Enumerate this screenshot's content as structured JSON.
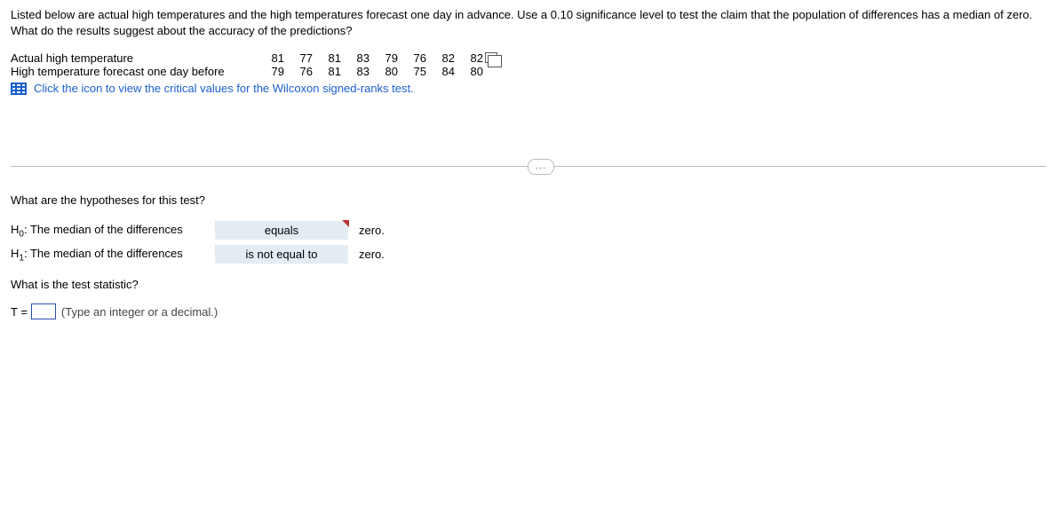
{
  "intro": {
    "line1": "Listed below are actual high temperatures and the high temperatures forecast one day in advance. Use a 0.10 significance level to test the claim that the population of differences has a median of zero.",
    "line2": "What do the results suggest about the accuracy of the predictions?"
  },
  "table": {
    "rows": [
      {
        "label": "Actual high temperature",
        "values": [
          "81",
          "77",
          "81",
          "83",
          "79",
          "76",
          "82",
          "82"
        ]
      },
      {
        "label": "High temperature forecast one day before",
        "values": [
          "79",
          "76",
          "81",
          "83",
          "80",
          "75",
          "84",
          "80"
        ]
      }
    ],
    "link_text": "Click the icon to view the critical values for the Wilcoxon signed-ranks test."
  },
  "ellipsis": "...",
  "hypotheses": {
    "question": "What are the hypotheses for this test?",
    "h0_prefix": "H",
    "h0_sub": "0",
    "h0_label": ": The median of the differences",
    "h0_select": "equals",
    "h0_after": "zero.",
    "h1_prefix": "H",
    "h1_sub": "1",
    "h1_label": ": The median of the differences",
    "h1_select": "is not equal to",
    "h1_after": "zero."
  },
  "statistic": {
    "question": "What is the test statistic?",
    "t_prefix": "T =",
    "hint": "(Type an integer or a decimal.)"
  }
}
